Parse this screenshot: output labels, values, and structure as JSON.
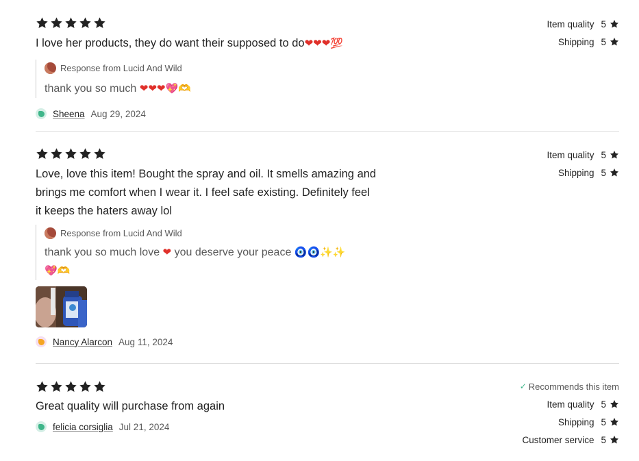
{
  "reviews": [
    {
      "stars": 5,
      "text": "I love her products, they do want their supposed to do",
      "text_emoji": "❤❤❤💯",
      "response": {
        "label": "Response from Lucid And Wild",
        "text": "thank you so much",
        "emoji": "❤❤❤💖🫶"
      },
      "user": "Sheena",
      "date": "Aug 29, 2024",
      "ratings": [
        {
          "label": "Item quality",
          "value": "5"
        },
        {
          "label": "Shipping",
          "value": "5"
        }
      ]
    },
    {
      "stars": 5,
      "text": "Love, love this item! Bought the spray and oil. It smells amazing and brings me comfort when I wear it. I feel safe existing. Definitely feel it keeps the haters away lol",
      "response": {
        "label": "Response from Lucid And Wild",
        "text": "thank you so much love",
        "text2": "you deserve your peace",
        "emoji": "🧿🧿✨✨",
        "emoji2": "💖🫶"
      },
      "user": "Nancy Alarcon",
      "date": "Aug 11, 2024",
      "ratings": [
        {
          "label": "Item quality",
          "value": "5"
        },
        {
          "label": "Shipping",
          "value": "5"
        }
      ]
    },
    {
      "stars": 5,
      "text": "Great quality will purchase from again",
      "recommends": "Recommends this item",
      "user": "felicia corsiglia",
      "date": "Jul 21, 2024",
      "ratings": [
        {
          "label": "Item quality",
          "value": "5"
        },
        {
          "label": "Shipping",
          "value": "5"
        },
        {
          "label": "Customer service",
          "value": "5"
        }
      ]
    }
  ],
  "colors": {
    "star": "#222222",
    "secondary_text": "#595959",
    "divider": "#dcdcdc",
    "recommend_check": "#3fb68a"
  }
}
